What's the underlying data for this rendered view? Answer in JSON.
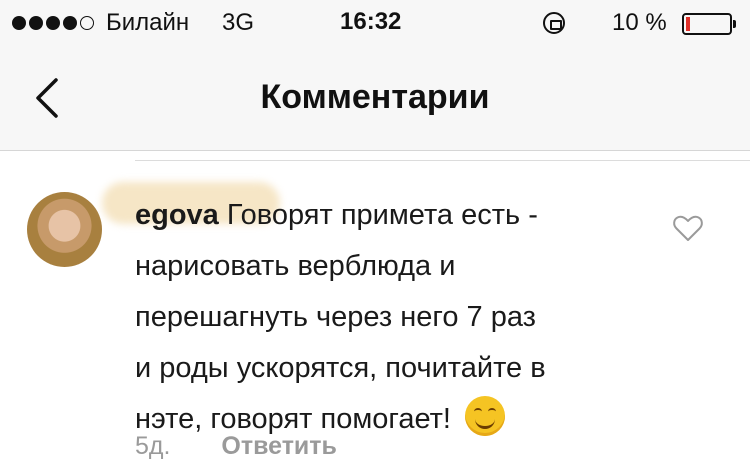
{
  "status_bar": {
    "carrier": "Билайн",
    "network": "3G",
    "time": "16:32",
    "battery_percent": "10 %",
    "battery_level": 0.1,
    "battery_low_color": "#e0302a"
  },
  "header": {
    "title": "Комментарии",
    "back_icon": "chevron-left-icon"
  },
  "comment": {
    "username_visible": "egova",
    "text": "Говорят примета есть - нарисовать верблюда и перешагнуть через него 7 раз и роды ускорятся, почитайте в нэте, говорят помогает!",
    "emoji_icon": "smiling-face-icon",
    "age": "5д.",
    "reply_label": "Ответить",
    "like_icon": "heart-outline-icon"
  }
}
